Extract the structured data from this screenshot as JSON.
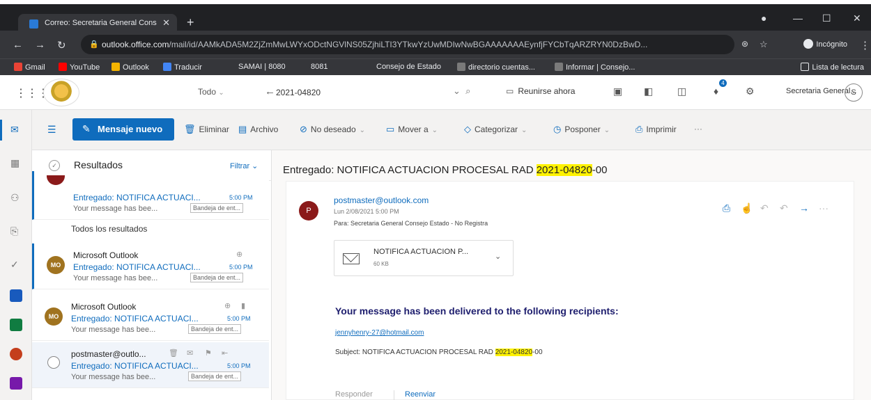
{
  "browser": {
    "tab_title": "Correo: Secretaria General Cons",
    "tab_close": "✕",
    "new_tab": "+",
    "url_host": "outlook.office.com",
    "url_path": "/mail/id/AAMkADA5M2ZjZmMwLWYxODctNGVlNS05ZjhiLTI3YTkwYzUwMDIwNwBGAAAAAAAEynfjFYCbTqARZRYN0DzBwD...",
    "incognito_label": "Incógnito",
    "bookmarks": [
      "Gmail",
      "YouTube",
      "Outlook",
      "Traducir",
      "SAMAI | 8080",
      "8081",
      "Consejo de Estado",
      "directorio cuentas...",
      "Informar | Consejo..."
    ],
    "reading_list": "Lista de lectura"
  },
  "header": {
    "search_scope": "Todo",
    "search_query": "2021-04820",
    "meet_now": "Reunirse ahora",
    "notification_count": "4",
    "account_name": "Secretaria General...",
    "account_initial": "S"
  },
  "commands": {
    "new_message": "Mensaje nuevo",
    "delete": "Eliminar",
    "archive": "Archivo",
    "junk": "No deseado",
    "move": "Mover a",
    "categorize": "Categorizar",
    "snooze": "Posponer",
    "print": "Imprimir",
    "more": "···"
  },
  "list": {
    "title": "Resultados",
    "filter": "Filtrar",
    "section_all": "Todos los resultados",
    "items": [
      {
        "sender": "",
        "subject": "Entregado: NOTIFICA ACTUACI...",
        "time": "5:00 PM",
        "preview": "Your message has bee...",
        "folder": "Bandeja de ent..."
      },
      {
        "sender": "Microsoft Outlook",
        "initials": "MO",
        "subject": "Entregado: NOTIFICA ACTUACI...",
        "time": "5:00 PM",
        "preview": "Your message has bee...",
        "folder": "Bandeja de ent..."
      },
      {
        "sender": "Microsoft Outlook",
        "initials": "MO",
        "subject": "Entregado: NOTIFICA ACTUACI...",
        "time": "5:00 PM",
        "preview": "Your message has bee...",
        "folder": "Bandeja de ent..."
      },
      {
        "sender": "postmaster@outlo...",
        "subject": "Entregado: NOTIFICA ACTUACI...",
        "time": "5:00 PM",
        "preview": "Your message has bee...",
        "folder": "Bandeja de ent..."
      }
    ]
  },
  "reader": {
    "title_prefix": "Entregado: NOTIFICA ACTUACION PROCESAL RAD ",
    "title_highlight": "2021-04820",
    "title_suffix": "-00",
    "sender_initial": "P",
    "from": "postmaster@outlook.com",
    "date": "Lun 2/08/2021 5:00 PM",
    "to": "Para: Secretaria General Consejo Estado - No Registra",
    "attachment_name": "NOTIFICA ACTUACION P...",
    "attachment_size": "60 KB",
    "delivered_heading": "Your message has been delivered to the following recipients:",
    "recipient": "jennyhenry-27@hotmail.com",
    "subject_prefix": "Subject: NOTIFICA ACTUACION PROCESAL RAD ",
    "subject_highlight": "2021-04820",
    "subject_suffix": "-00",
    "reply": "Responder",
    "forward": "Reenviar"
  },
  "colors": {
    "accent": "#0f6cbd",
    "highlight": "#fff200",
    "chrome_dark": "#202124"
  }
}
